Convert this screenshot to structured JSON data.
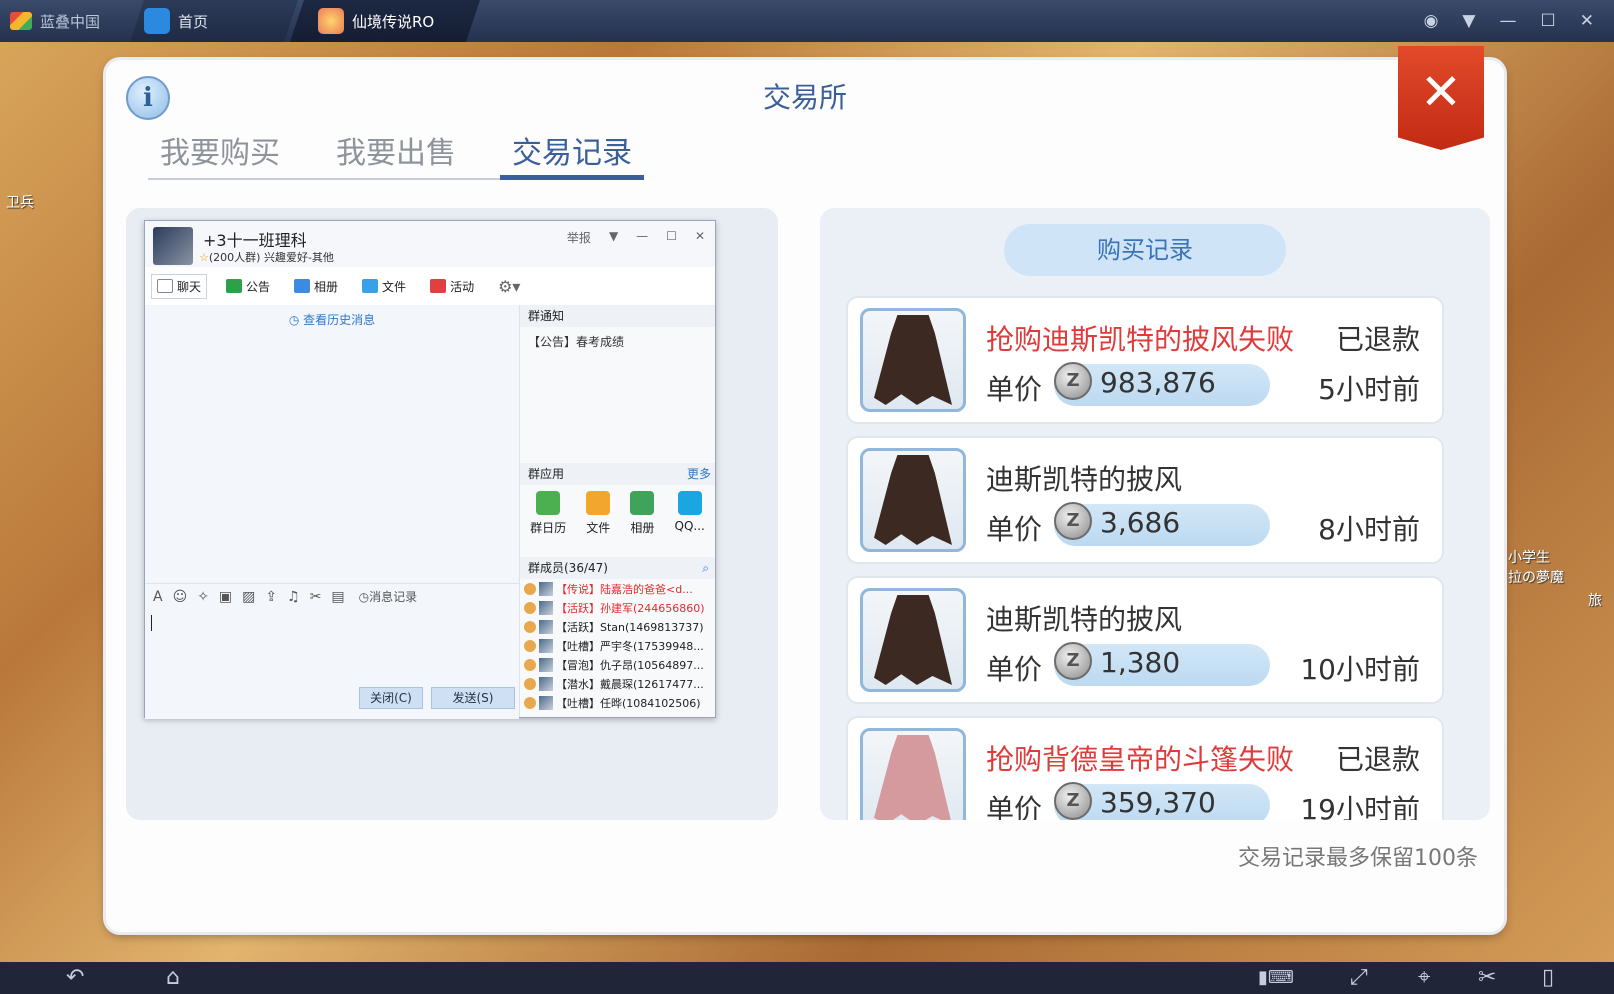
{
  "bluestacks": {
    "brand": "蓝叠中国",
    "tabs": [
      {
        "label": "首页"
      },
      {
        "label": "仙境传说RO"
      }
    ]
  },
  "game_side": {
    "left_label": "卫兵",
    "right_label_1": "小学生",
    "right_label_2": "拉の夢魔",
    "right_label_3": "旅"
  },
  "exchange": {
    "title": "交易所",
    "tabs": [
      "我要购买",
      "我要出售",
      "交易记录"
    ],
    "active_tab": "交易记录",
    "section_title": "购买记录",
    "footnote": "交易记录最多保留100条",
    "unit_price_label": "单价",
    "records": [
      {
        "name": "抢购迪斯凯特的披风失败",
        "failed": true,
        "status": "已退款",
        "price": "983,876",
        "time": "5小时前",
        "color": "#3c2a22"
      },
      {
        "name": "迪斯凯特的披风",
        "failed": false,
        "status": "",
        "price": "3,686",
        "time": "8小时前",
        "color": "#3c2a22"
      },
      {
        "name": "迪斯凯特的披风",
        "failed": false,
        "status": "",
        "price": "1,380",
        "time": "10小时前",
        "color": "#3c2a22"
      },
      {
        "name": "抢购背德皇帝的斗篷失败",
        "failed": true,
        "status": "已退款",
        "price": "359,370",
        "time": "19小时前",
        "color": "#d49a9e"
      }
    ]
  },
  "qq": {
    "group_name": "+3十一班理科",
    "group_sub": "(200人群) 兴趣爱好-其他",
    "report": "举报",
    "tabs": [
      "聊天",
      "公告",
      "相册",
      "文件",
      "活动"
    ],
    "history_link": "查看历史消息",
    "msg_record": "消息记录",
    "close_btn": "关闭(C)",
    "send_btn": "发送(S)",
    "notice_header": "群通知",
    "notice_text": "【公告】春考成绩",
    "apps_header": "群应用",
    "apps_more": "更多",
    "apps": [
      "群日历",
      "文件",
      "相册",
      "QQ..."
    ],
    "members_header": "群成员(36/47)",
    "members": [
      {
        "text": "【传说】陆嘉浩的爸爸<d...",
        "red": true
      },
      {
        "text": "【活跃】孙建军(244656860)",
        "red": true
      },
      {
        "text": "【活跃】Stan(1469813737)",
        "red": false
      },
      {
        "text": "【吐槽】严宇冬(17539948...",
        "red": false
      },
      {
        "text": "【冒泡】仇子昂(10564897...",
        "red": false
      },
      {
        "text": "【潜水】戴晨琛(12617477...",
        "red": false
      },
      {
        "text": "【吐槽】任晔(1084102506)",
        "red": false
      }
    ]
  }
}
